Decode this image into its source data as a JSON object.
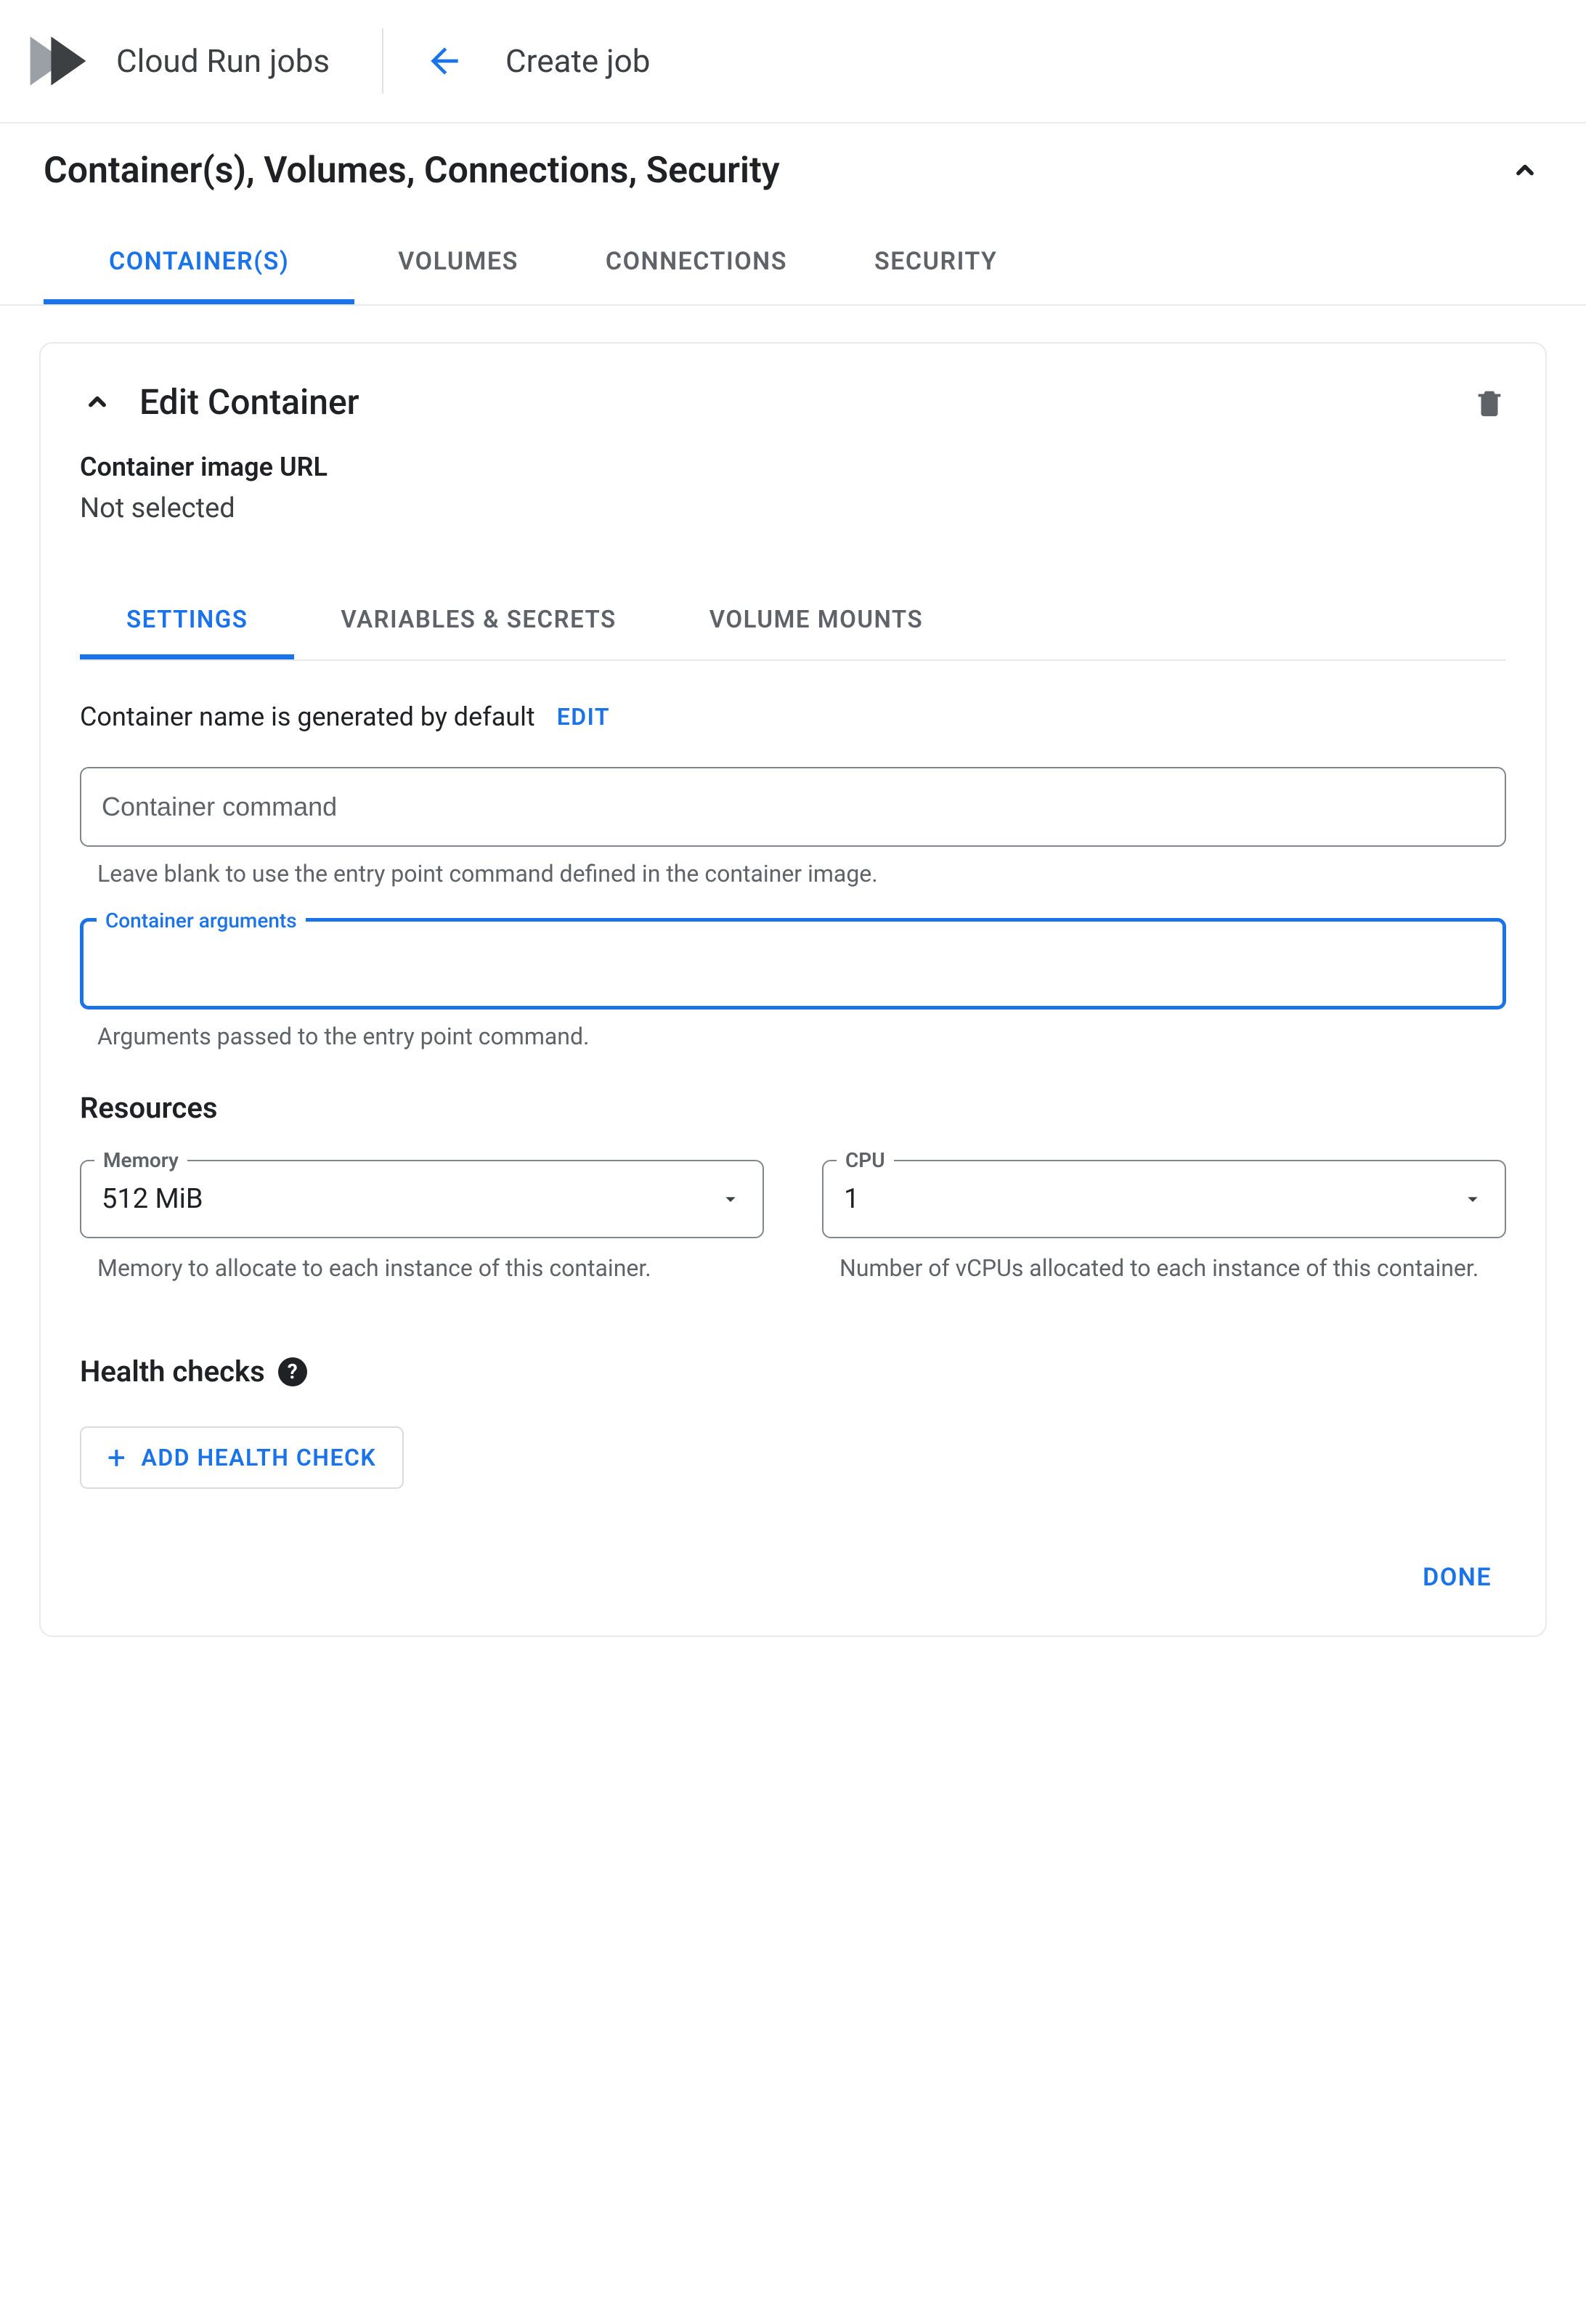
{
  "appbar": {
    "product": "Cloud Run jobs",
    "page_title": "Create job"
  },
  "section": {
    "title": "Container(s), Volumes, Connections, Security",
    "tabs": [
      "CONTAINER(S)",
      "VOLUMES",
      "CONNECTIONS",
      "SECURITY"
    ],
    "active_tab": 0
  },
  "card": {
    "title": "Edit Container",
    "image_url": {
      "label": "Container image URL",
      "value": "Not selected"
    },
    "inner_tabs": [
      "SETTINGS",
      "VARIABLES & SECRETS",
      "VOLUME MOUNTS"
    ],
    "active_inner_tab": 0,
    "name_row": {
      "desc": "Container name is generated by default",
      "edit": "EDIT"
    },
    "command": {
      "placeholder": "Container command",
      "value": "",
      "helper": "Leave blank to use the entry point command defined in the container image."
    },
    "arguments": {
      "label": "Container arguments",
      "value": "",
      "helper": "Arguments passed to the entry point command."
    },
    "resources": {
      "heading": "Resources",
      "memory": {
        "label": "Memory",
        "value": "512 MiB",
        "helper": "Memory to allocate to each instance of this container."
      },
      "cpu": {
        "label": "CPU",
        "value": "1",
        "helper": "Number of vCPUs allocated to each instance of this container."
      }
    },
    "health": {
      "heading": "Health checks",
      "add_label": "ADD HEALTH CHECK"
    },
    "done": "DONE"
  }
}
